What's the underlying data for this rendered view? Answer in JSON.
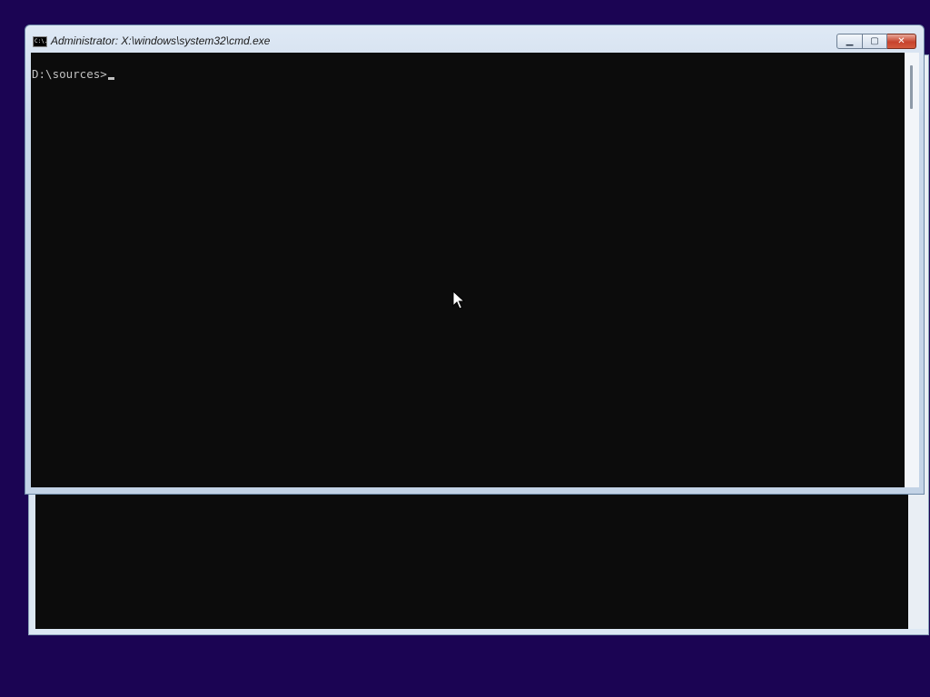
{
  "window": {
    "title": "Administrator: X:\\windows\\system32\\cmd.exe",
    "icon": "cmd-icon",
    "icon_text": "C:\\.",
    "minimize_glyph": "▁",
    "maximize_glyph": "▢",
    "close_glyph": "✕"
  },
  "console": {
    "prompt": "D:\\sources>"
  }
}
